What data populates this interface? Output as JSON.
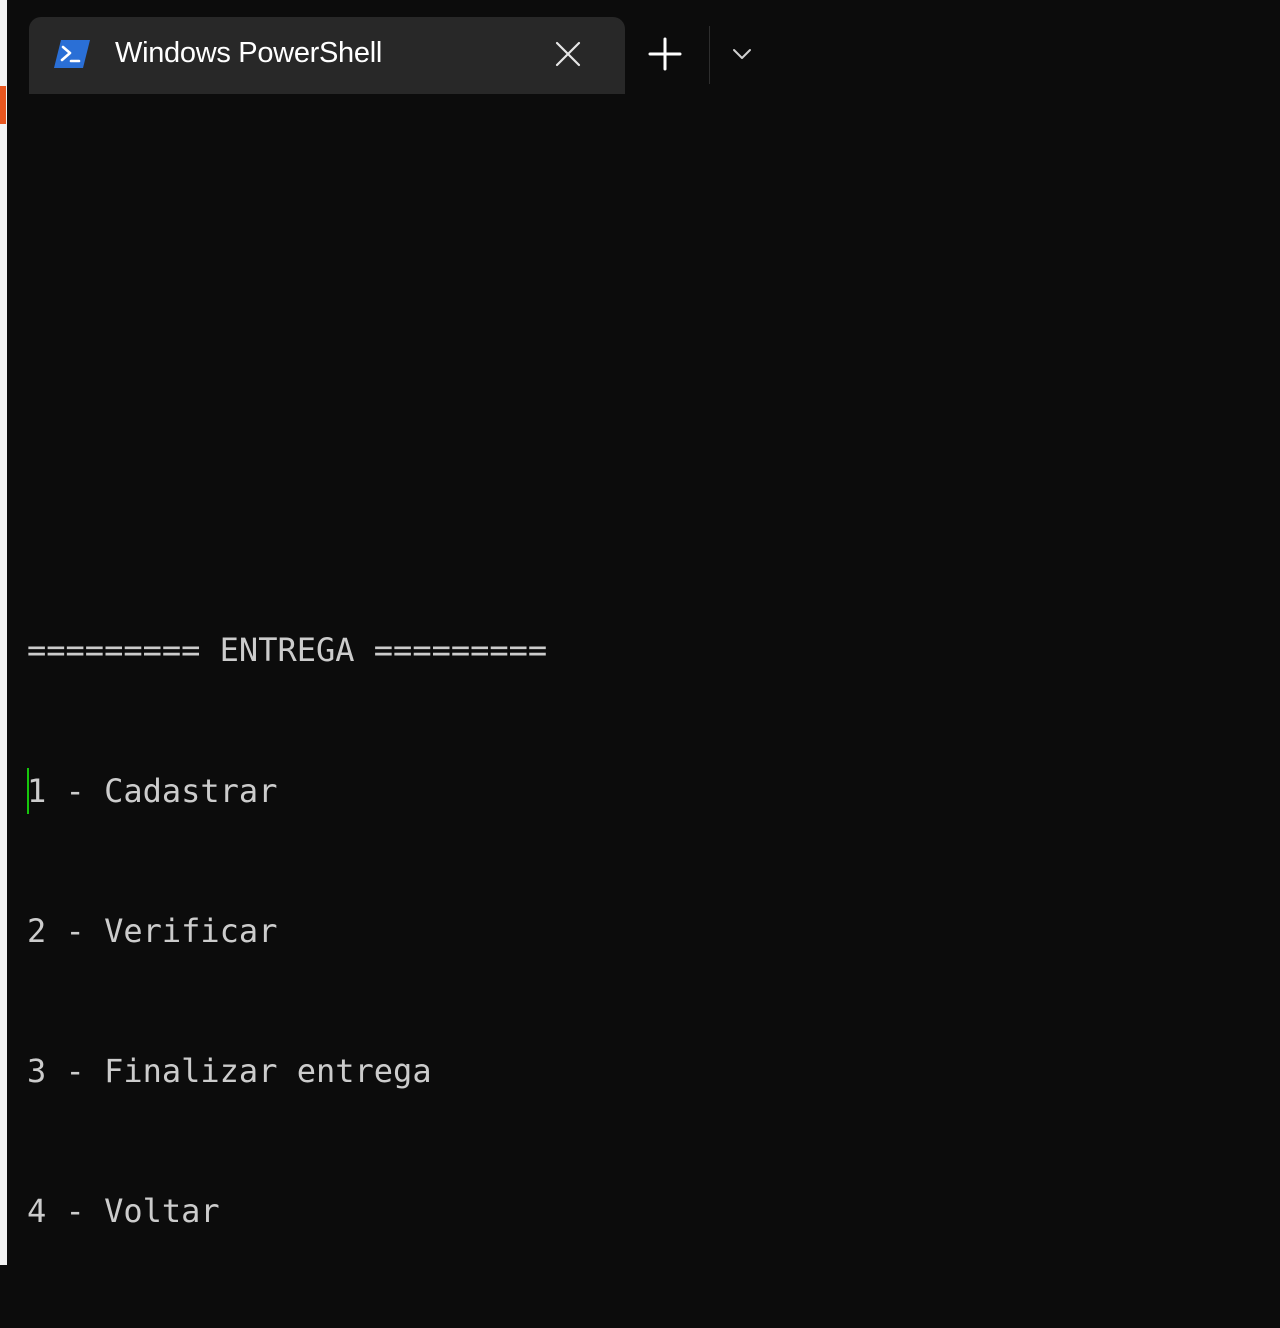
{
  "window": {
    "tab": {
      "title": "Windows PowerShell",
      "icon": "powershell-icon",
      "close_icon": "close-icon"
    },
    "new_tab_icon": "plus-icon",
    "dropdown_icon": "chevron-down-icon"
  },
  "terminal": {
    "lines": [
      "========= ENTREGA =========",
      "1 - Cadastrar",
      "2 - Verificar",
      "3 - Finalizar entrega",
      "4 - Voltar"
    ]
  },
  "colors": {
    "background": "#0c0c0c",
    "tab_background": "#282828",
    "text": "#cccccc",
    "cursor": "#16c60c",
    "powershell_blue": "#2a6fd6"
  }
}
